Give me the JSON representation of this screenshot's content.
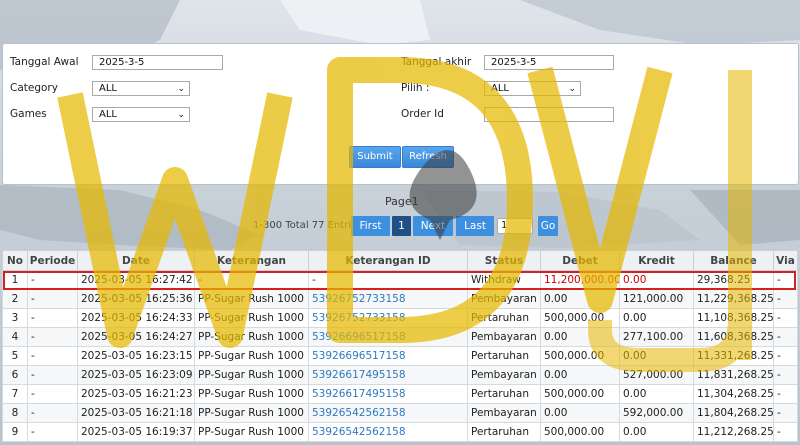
{
  "form": {
    "tanggal_awal_label": "Tanggal Awal",
    "tanggal_awal_value": "2025-3-5",
    "tanggal_akhir_label": "Tanggal akhir",
    "tanggal_akhir_value": "2025-3-5",
    "category_label": "Category",
    "category_value": "ALL",
    "pilih_label": "Pilih  :",
    "pilih_value": "ALL",
    "games_label": "Games",
    "games_value": "ALL",
    "order_id_label": "Order Id",
    "order_id_value": "",
    "submit_label": "Submit",
    "refresh_label": "Refresh"
  },
  "pager": {
    "title": "Page1",
    "info": "1-300 Total 77 Entri",
    "first": "First",
    "current": "1",
    "next": "Next",
    "last": "Last",
    "page_input": "1",
    "go": "Go"
  },
  "table": {
    "headers": [
      "No",
      "Periode",
      "Date",
      "Keterangan",
      "Keterangan ID",
      "Status",
      "Debet",
      "Kredit",
      "Balance",
      "Via"
    ],
    "rows": [
      [
        "1",
        "-",
        "2025-03-05 16:27:42",
        "-",
        "-",
        "Withdraw",
        "11,200,000.00",
        "0.00",
        "29,368.25",
        "-"
      ],
      [
        "2",
        "-",
        "2025-03-05 16:25:36",
        "PP-Sugar Rush 1000",
        "53926752733158",
        "Pembayaran",
        "0.00",
        "121,000.00",
        "11,229,368.25",
        "-"
      ],
      [
        "3",
        "-",
        "2025-03-05 16:24:33",
        "PP-Sugar Rush 1000",
        "53926752733158",
        "Pertaruhan",
        "500,000.00",
        "0.00",
        "11,108,368.25",
        "-"
      ],
      [
        "4",
        "-",
        "2025-03-05 16:24:27",
        "PP-Sugar Rush 1000",
        "53926696517158",
        "Pembayaran",
        "0.00",
        "277,100.00",
        "11,608,368.25",
        "-"
      ],
      [
        "5",
        "-",
        "2025-03-05 16:23:15",
        "PP-Sugar Rush 1000",
        "53926696517158",
        "Pertaruhan",
        "500,000.00",
        "0.00",
        "11,331,268.25",
        "-"
      ],
      [
        "6",
        "-",
        "2025-03-05 16:23:09",
        "PP-Sugar Rush 1000",
        "53926617495158",
        "Pembayaran",
        "0.00",
        "527,000.00",
        "11,831,268.25",
        "-"
      ],
      [
        "7",
        "-",
        "2025-03-05 16:21:23",
        "PP-Sugar Rush 1000",
        "53926617495158",
        "Pertaruhan",
        "500,000.00",
        "0.00",
        "11,304,268.25",
        "-"
      ],
      [
        "8",
        "-",
        "2025-03-05 16:21:18",
        "PP-Sugar Rush 1000",
        "53926542562158",
        "Pembayaran",
        "0.00",
        "592,000.00",
        "11,804,268.25",
        "-"
      ],
      [
        "9",
        "-",
        "2025-03-05 16:19:37",
        "PP-Sugar Rush 1000",
        "53926542562158",
        "Pertaruhan",
        "500,000.00",
        "0.00",
        "11,212,268.25",
        "-"
      ]
    ]
  },
  "watermark": {
    "text": "WDVUK",
    "color": "#e6b800"
  }
}
